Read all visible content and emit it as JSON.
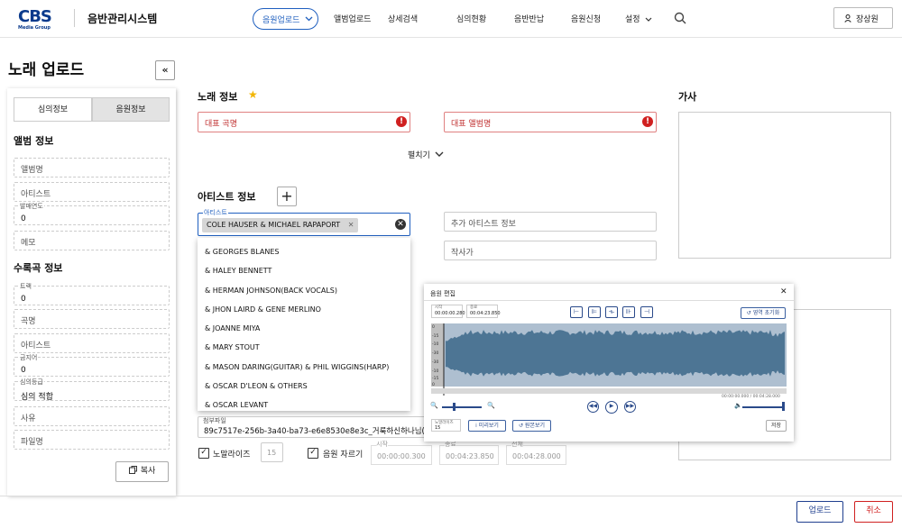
{
  "header": {
    "logo": "CBS",
    "logo_sub": "Media Group",
    "app_title": "음반관리시스템",
    "nav": [
      "음원업로드",
      "앨범업로드",
      "상세검색",
      "심의현황",
      "음반반납",
      "음원신청",
      "설정"
    ],
    "user": "장상원"
  },
  "page": {
    "title": "노래 업로드"
  },
  "left": {
    "tabs": [
      "심의정보",
      "음원정보"
    ],
    "album_section": "앨범 정보",
    "album_name_placeholder": "앨범명",
    "artist_placeholder": "아티스트",
    "release_year_label": "발매연도",
    "release_year_value": "0",
    "memo_placeholder": "메모",
    "track_section": "수록곡 정보",
    "track_label": "트랙",
    "track_value": "0",
    "song_placeholder": "곡명",
    "track_artist_placeholder": "아티스트",
    "ban_label": "금지어",
    "ban_value": "0",
    "grade_label": "심의등급",
    "grade_value": "심의 적합",
    "reason_placeholder": "사유",
    "filename_placeholder": "파일명",
    "copy_label": "복사"
  },
  "main": {
    "song_section": "노래 정보",
    "rep_title": "대표 곡명",
    "rep_album": "대표 앨범명",
    "expand": "펼치기",
    "lyrics_title": "가사",
    "artist_section": "아티스트 정보",
    "artist_field_label": "아티스트",
    "artist_chip": "COLE HAUSER & MICHAEL RAPAPORT",
    "extra_artist": "추가 아티스트 정보",
    "composer": "작사가",
    "dropdown": [
      "& GEORGES BLANES",
      "& HALEY BENNETT",
      "& HERMAN JOHNSON(BACK VOCALS)",
      "& JHON LAIRD & GENE MERLINO",
      "& JOANNE MIYA",
      "& MARY STOUT",
      "& MASON DARING(GUITAR) & PHIL WIGGINS(HARP)",
      "& OSCAR D'LEON & OTHERS",
      "& OSCAR LEVANT"
    ],
    "attach_label": "첨부파일",
    "attach_value": "89c7517e-256b-3a40-ba73-e6e8530e8e3c_거룩하신하나님(H",
    "normalize_label": "노말라이즈",
    "normalize_value": "15",
    "trim_label": "음원 자르기",
    "start_label": "시작",
    "start_value": "00:00:00.300",
    "end_label": "종료",
    "end_value": "00:04:23.850",
    "total_label": "전체",
    "total_value": "00:04:28.000"
  },
  "modal": {
    "title": "음원 편집",
    "start_label": "시작",
    "start_value": "00:00:00.280",
    "end_label": "종료",
    "end_value": "00:04:23.850",
    "reset_region": "영역 초기화",
    "timeline": "00:00:00.000 / 00:04:28.000",
    "normalize_label": "노말라이즈",
    "normalize_value": "15",
    "preview": "미리보기",
    "original": "원본보기",
    "save": "저장",
    "y_ticks": [
      "0",
      "-15",
      "-10",
      "-30",
      "-30",
      "-10",
      "-15",
      "0"
    ]
  },
  "footer": {
    "upload": "업로드",
    "cancel": "취소"
  },
  "colors": {
    "primary": "#1f5fbf",
    "error": "#d02020",
    "wave": "#4d7594"
  }
}
